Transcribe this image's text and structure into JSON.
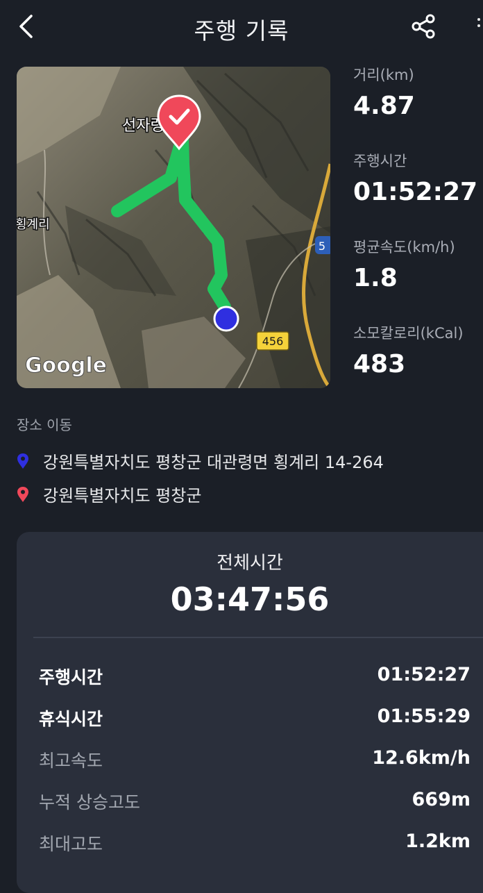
{
  "header": {
    "title": "주행 기록",
    "back_icon": "chevron-left-icon",
    "share_icon": "share-icon"
  },
  "map": {
    "place_label": "선자령",
    "side_label": "횡계리",
    "road_number": "456",
    "highway_number": "5",
    "brand": "Google",
    "route_color": "#22c55e",
    "start_marker_color": "#2f2fe0",
    "end_marker_color": "#f0485a"
  },
  "stats": [
    {
      "label": "거리(km)",
      "value": "4.87"
    },
    {
      "label": "주행시간",
      "value": "01:52:27"
    },
    {
      "label": "평균속도(km/h)",
      "value": "1.8"
    },
    {
      "label": "소모칼로리(kCal)",
      "value": "483"
    }
  ],
  "locations": {
    "heading": "장소 이동",
    "start": "강원특별자치도 평창군 대관령면 횡계리 14-264",
    "end": "강원특별자치도 평창군"
  },
  "summary": {
    "title": "전체시간",
    "total": "03:47:56",
    "rows": [
      {
        "label": "주행시간",
        "value": "01:52:27"
      },
      {
        "label": "휴식시간",
        "value": "01:55:29"
      },
      {
        "label": "최고속도",
        "value": "12.6km/h"
      },
      {
        "label": "누적 상승고도",
        "value": "669m"
      },
      {
        "label": "최대고도",
        "value": "1.2km"
      }
    ]
  },
  "colors": {
    "background": "#1b1f27",
    "card": "#2a2f3b",
    "start_pin": "#2f2fe0",
    "end_pin": "#f0485a"
  }
}
